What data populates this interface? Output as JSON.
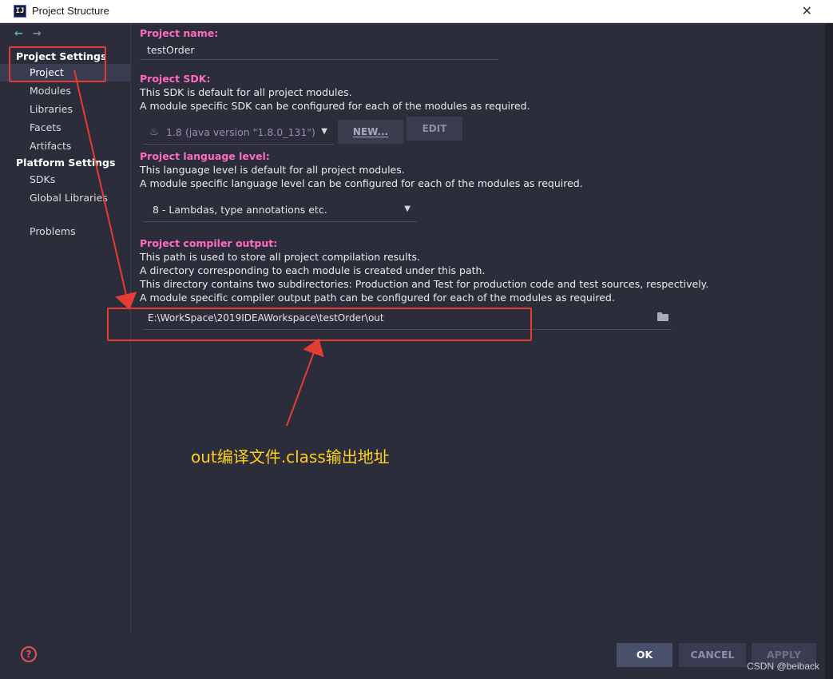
{
  "window": {
    "title": "Project Structure",
    "app_icon": "IJ",
    "close": "✕"
  },
  "nav": {
    "back": "🡐",
    "forward": "🡒"
  },
  "sidebar": {
    "project_settings_heading": "Project Settings",
    "project_settings_items": [
      "Project",
      "Modules",
      "Libraries",
      "Facets",
      "Artifacts"
    ],
    "platform_settings_heading": "Platform Settings",
    "platform_settings_items": [
      "SDKs",
      "Global Libraries"
    ],
    "problems": "Problems",
    "selected": "Project"
  },
  "content": {
    "project_name_label": "Project name:",
    "project_name_value": "testOrder",
    "sdk_label": "Project SDK:",
    "sdk_desc_1": "This SDK is default for all project modules.",
    "sdk_desc_2": "A module specific SDK can be configured for each of the modules as required.",
    "sdk_value": "1.8 (java version \"1.8.0_131\")",
    "sdk_new_button": "NEW...",
    "sdk_edit_button": "EDIT",
    "lang_label": "Project language level:",
    "lang_desc_1": "This language level is default for all project modules.",
    "lang_desc_2": "A module specific language level can be configured for each of the modules as required.",
    "lang_value": "8 - Lambdas, type annotations etc.",
    "output_label": "Project compiler output:",
    "output_desc_1": "This path is used to store all project compilation results.",
    "output_desc_2": "A directory corresponding to each module is created under this path.",
    "output_desc_3": "This directory contains two subdirectories: Production and Test for production code and test sources, respectively.",
    "output_desc_4": "A module specific compiler output path can be configured for each of the modules as required.",
    "output_value": "E:\\WorkSpace\\2019IDEAWorkspace\\testOrder\\out"
  },
  "annotation": {
    "text": "out编译文件.class输出地址",
    "color": "#ffcf1f",
    "box_color": "#e53d34"
  },
  "footer": {
    "help": "?",
    "ok": "OK",
    "cancel": "CANCEL",
    "apply": "APPLY"
  },
  "watermark": "CSDN @beiback",
  "colors": {
    "section_title": "#ff6bc1",
    "background": "#2b2d3a",
    "selected_item": "#3a3d52"
  }
}
